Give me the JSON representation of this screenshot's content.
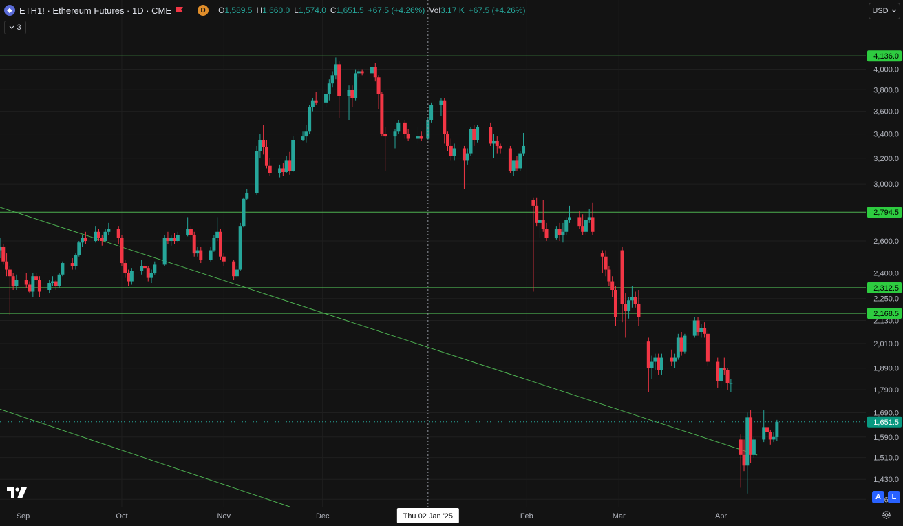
{
  "header": {
    "symbol_title": "ETH1! · Ethereum Futures · 1D · CME",
    "d_badge": "D",
    "ohlc": {
      "o_label": "O",
      "o_value": "1,589.5",
      "h_label": "H",
      "h_value": "1,660.0",
      "l_label": "L",
      "l_value": "1,574.0",
      "c_label": "C",
      "c_value": "1,651.5",
      "change": "+67.5 (+4.26%)",
      "vol_label": "Vol",
      "vol_value": "3.17 K",
      "vol_change": "+67.5 (+4.26%)"
    }
  },
  "indicator_count": "3",
  "currency_button": "USD",
  "auto_button": "A",
  "log_button": "L",
  "colors": {
    "background": "#131313",
    "up": "#26a69a",
    "down": "#f23645",
    "level_line": "#4caf50",
    "level_label": "#2ecc40",
    "last_price_label": "#089981"
  },
  "icons": [
    "ethereum-icon",
    "flag-icon",
    "chevron-down-icon",
    "tradingview-logo",
    "gear-icon"
  ],
  "chart_data": {
    "type": "candlestick",
    "scale": "log",
    "ylim": [
      1335,
      4380
    ],
    "y_ticks": [
      "4,000.0",
      "3,800.0",
      "3,600.0",
      "3,400.0",
      "3,200.0",
      "3,000.0",
      "2,600.0",
      "2,400.0",
      "2,250.0",
      "2,130.0",
      "2,010.0",
      "1,890.0",
      "1,790.0",
      "1,690.0",
      "1,590.0",
      "1,510.0",
      "1,430.0",
      "1,360.0"
    ],
    "x_ticks": [
      {
        "date": "2024-09-01",
        "label": "Sep"
      },
      {
        "date": "2024-10-01",
        "label": "Oct"
      },
      {
        "date": "2024-11-01",
        "label": "Nov"
      },
      {
        "date": "2024-12-01",
        "label": "Dec"
      },
      {
        "date": "2025-02-01",
        "label": "Feb"
      },
      {
        "date": "2025-03-01",
        "label": "Mar"
      },
      {
        "date": "2025-04-01",
        "label": "Apr"
      }
    ],
    "x_range": [
      "2024-08-25",
      "2025-05-15"
    ],
    "crosshair": {
      "date": "2025-01-02",
      "label": "Thu 02 Jan '25"
    },
    "horizontal_levels": [
      {
        "value": 4136.0,
        "label": "4,136.0"
      },
      {
        "value": 2794.5,
        "label": "2,794.5"
      },
      {
        "value": 2312.5,
        "label": "2,312.5"
      },
      {
        "value": 2168.5,
        "label": "2,168.5"
      }
    ],
    "last_price": {
      "value": 1651.5,
      "label": "1,651.5"
    },
    "trend_lines": [
      {
        "from": [
          "2024-08-25",
          2830
        ],
        "to": [
          "2025-04-12",
          1520
        ]
      },
      {
        "from": [
          "2024-08-25",
          1705
        ],
        "to": [
          "2024-11-21",
          1335
        ]
      }
    ],
    "candles": [
      [
        "2024-08-25",
        2540,
        2620,
        2490,
        2560
      ],
      [
        "2024-08-26",
        2560,
        2580,
        2450,
        2470
      ],
      [
        "2024-08-27",
        2470,
        2520,
        2380,
        2420
      ],
      [
        "2024-08-28",
        2420,
        2440,
        2160,
        2380
      ],
      [
        "2024-08-29",
        2380,
        2400,
        2300,
        2320
      ],
      [
        "2024-08-30",
        2320,
        2390,
        2300,
        2360
      ],
      [
        "2024-09-02",
        2360,
        2400,
        2310,
        2330
      ],
      [
        "2024-09-03",
        2330,
        2350,
        2280,
        2290
      ],
      [
        "2024-09-04",
        2290,
        2400,
        2260,
        2380
      ],
      [
        "2024-09-05",
        2380,
        2400,
        2330,
        2360
      ],
      [
        "2024-09-06",
        2360,
        2380,
        2260,
        2290
      ],
      [
        "2024-09-09",
        2300,
        2360,
        2280,
        2340
      ],
      [
        "2024-09-10",
        2340,
        2380,
        2320,
        2350
      ],
      [
        "2024-09-11",
        2350,
        2360,
        2300,
        2320
      ],
      [
        "2024-09-12",
        2320,
        2400,
        2310,
        2390
      ],
      [
        "2024-09-13",
        2390,
        2470,
        2380,
        2460
      ],
      [
        "2024-09-16",
        2460,
        2490,
        2420,
        2440
      ],
      [
        "2024-09-17",
        2440,
        2520,
        2420,
        2510
      ],
      [
        "2024-09-18",
        2510,
        2600,
        2500,
        2590
      ],
      [
        "2024-09-19",
        2590,
        2640,
        2560,
        2620
      ],
      [
        "2024-09-20",
        2620,
        2660,
        2580,
        2600
      ],
      [
        "2024-09-23",
        2600,
        2700,
        2590,
        2660
      ],
      [
        "2024-09-24",
        2660,
        2680,
        2600,
        2620
      ],
      [
        "2024-09-25",
        2620,
        2640,
        2570,
        2600
      ],
      [
        "2024-09-26",
        2600,
        2680,
        2590,
        2660
      ],
      [
        "2024-09-27",
        2660,
        2720,
        2640,
        2680
      ],
      [
        "2024-09-30",
        2680,
        2700,
        2580,
        2620
      ],
      [
        "2024-10-01",
        2620,
        2640,
        2440,
        2460
      ],
      [
        "2024-10-02",
        2460,
        2480,
        2370,
        2400
      ],
      [
        "2024-10-03",
        2400,
        2420,
        2320,
        2350
      ],
      [
        "2024-10-04",
        2350,
        2430,
        2330,
        2410
      ],
      [
        "2024-10-07",
        2410,
        2480,
        2390,
        2440
      ],
      [
        "2024-10-08",
        2440,
        2460,
        2400,
        2430
      ],
      [
        "2024-10-09",
        2430,
        2440,
        2350,
        2370
      ],
      [
        "2024-10-10",
        2370,
        2420,
        2340,
        2400
      ],
      [
        "2024-10-11",
        2400,
        2470,
        2390,
        2450
      ],
      [
        "2024-10-14",
        2450,
        2640,
        2440,
        2620
      ],
      [
        "2024-10-15",
        2620,
        2660,
        2580,
        2600
      ],
      [
        "2024-10-16",
        2600,
        2640,
        2570,
        2620
      ],
      [
        "2024-10-17",
        2620,
        2650,
        2580,
        2600
      ],
      [
        "2024-10-18",
        2600,
        2660,
        2590,
        2640
      ],
      [
        "2024-10-21",
        2640,
        2760,
        2630,
        2680
      ],
      [
        "2024-10-22",
        2680,
        2700,
        2610,
        2640
      ],
      [
        "2024-10-23",
        2640,
        2660,
        2500,
        2520
      ],
      [
        "2024-10-24",
        2520,
        2560,
        2500,
        2540
      ],
      [
        "2024-10-25",
        2540,
        2560,
        2460,
        2480
      ],
      [
        "2024-10-28",
        2480,
        2560,
        2470,
        2540
      ],
      [
        "2024-10-29",
        2540,
        2640,
        2530,
        2620
      ],
      [
        "2024-10-30",
        2620,
        2760,
        2600,
        2660
      ],
      [
        "2024-10-31",
        2660,
        2680,
        2480,
        2500
      ],
      [
        "2024-11-01",
        2500,
        2520,
        2440,
        2470
      ],
      [
        "2024-11-04",
        2470,
        2480,
        2360,
        2380
      ],
      [
        "2024-11-05",
        2380,
        2440,
        2370,
        2420
      ],
      [
        "2024-11-06",
        2420,
        2720,
        2410,
        2700
      ],
      [
        "2024-11-07",
        2700,
        2900,
        2690,
        2890
      ],
      [
        "2024-11-08",
        2890,
        2960,
        2880,
        2930
      ],
      [
        "2024-11-11",
        2930,
        3300,
        2920,
        3260
      ],
      [
        "2024-11-12",
        3260,
        3400,
        3200,
        3350
      ],
      [
        "2024-11-13",
        3350,
        3480,
        3230,
        3290
      ],
      [
        "2024-11-14",
        3290,
        3350,
        3120,
        3140
      ],
      [
        "2024-11-15",
        3140,
        3200,
        3060,
        3080
      ],
      [
        "2024-11-18",
        3080,
        3150,
        3050,
        3120
      ],
      [
        "2024-11-19",
        3120,
        3160,
        3060,
        3090
      ],
      [
        "2024-11-20",
        3090,
        3220,
        3080,
        3180
      ],
      [
        "2024-11-21",
        3180,
        3250,
        3070,
        3100
      ],
      [
        "2024-11-22",
        3100,
        3380,
        3090,
        3350
      ],
      [
        "2024-11-25",
        3350,
        3420,
        3340,
        3380
      ],
      [
        "2024-11-26",
        3380,
        3480,
        3330,
        3420
      ],
      [
        "2024-11-27",
        3420,
        3660,
        3400,
        3640
      ],
      [
        "2024-11-28",
        3640,
        3720,
        3600,
        3700
      ],
      [
        "2024-11-29",
        3700,
        3780,
        3660,
        3680
      ],
      [
        "2024-12-02",
        3680,
        3800,
        3640,
        3760
      ],
      [
        "2024-12-03",
        3760,
        3900,
        3700,
        3860
      ],
      [
        "2024-12-04",
        3860,
        3980,
        3820,
        3940
      ],
      [
        "2024-12-05",
        3940,
        4120,
        3900,
        4050
      ],
      [
        "2024-12-06",
        4050,
        4080,
        3540,
        3740
      ],
      [
        "2024-12-09",
        3740,
        3840,
        3520,
        3800
      ],
      [
        "2024-12-10",
        3800,
        3840,
        3640,
        3720
      ],
      [
        "2024-12-11",
        3720,
        4000,
        3700,
        3960
      ],
      [
        "2024-12-12",
        3960,
        4000,
        3920,
        3980
      ],
      [
        "2024-12-13",
        3980,
        4000,
        3940,
        3960
      ],
      [
        "2024-12-16",
        3960,
        4100,
        3940,
        4020
      ],
      [
        "2024-12-17",
        4020,
        4060,
        3880,
        3920
      ],
      [
        "2024-12-18",
        3920,
        3940,
        3620,
        3760
      ],
      [
        "2024-12-19",
        3760,
        3780,
        3380,
        3400
      ],
      [
        "2024-12-20",
        3400,
        3460,
        3100,
        3380
      ],
      [
        "2024-12-23",
        3380,
        3440,
        3280,
        3420
      ],
      [
        "2024-12-24",
        3420,
        3520,
        3400,
        3500
      ],
      [
        "2024-12-26",
        3500,
        3520,
        3360,
        3400
      ],
      [
        "2024-12-27",
        3400,
        3440,
        3340,
        3360
      ],
      [
        "2024-12-30",
        3360,
        3460,
        3320,
        3380
      ],
      [
        "2024-12-31",
        3380,
        3420,
        3340,
        3360
      ],
      [
        "2025-01-02",
        3360,
        3540,
        3350,
        3520
      ],
      [
        "2025-01-03",
        3520,
        3680,
        3500,
        3660
      ],
      [
        "2025-01-06",
        3660,
        3720,
        3560,
        3700
      ],
      [
        "2025-01-07",
        3700,
        3720,
        3320,
        3400
      ],
      [
        "2025-01-08",
        3400,
        3420,
        3260,
        3300
      ],
      [
        "2025-01-09",
        3300,
        3360,
        3180,
        3220
      ],
      [
        "2025-01-10",
        3220,
        3320,
        3180,
        3280
      ],
      [
        "2025-01-13",
        3280,
        3300,
        2960,
        3180
      ],
      [
        "2025-01-14",
        3180,
        3280,
        3150,
        3240
      ],
      [
        "2025-01-15",
        3240,
        3460,
        3220,
        3440
      ],
      [
        "2025-01-16",
        3440,
        3480,
        3300,
        3350
      ],
      [
        "2025-01-17",
        3350,
        3480,
        3330,
        3460
      ],
      [
        "2025-01-21",
        3460,
        3500,
        3300,
        3320
      ],
      [
        "2025-01-22",
        3320,
        3400,
        3200,
        3340
      ],
      [
        "2025-01-23",
        3340,
        3380,
        3240,
        3300
      ],
      [
        "2025-01-24",
        3300,
        3320,
        3240,
        3280
      ],
      [
        "2025-01-27",
        3280,
        3300,
        3080,
        3100
      ],
      [
        "2025-01-28",
        3100,
        3180,
        3060,
        3180
      ],
      [
        "2025-01-29",
        3180,
        3220,
        3100,
        3120
      ],
      [
        "2025-01-30",
        3120,
        3260,
        3100,
        3240
      ],
      [
        "2025-01-31",
        3240,
        3410,
        3220,
        3300
      ],
      [
        "2025-02-03",
        2880,
        2900,
        2290,
        2840
      ],
      [
        "2025-02-04",
        2840,
        2900,
        2700,
        2720
      ],
      [
        "2025-02-05",
        2720,
        2780,
        2620,
        2740
      ],
      [
        "2025-02-06",
        2740,
        2880,
        2660,
        2680
      ],
      [
        "2025-02-07",
        2680,
        2720,
        2600,
        2620
      ],
      [
        "2025-02-10",
        2620,
        2700,
        2610,
        2680
      ],
      [
        "2025-02-11",
        2680,
        2720,
        2600,
        2640
      ],
      [
        "2025-02-12",
        2640,
        2720,
        2590,
        2660
      ],
      [
        "2025-02-13",
        2660,
        2760,
        2640,
        2740
      ],
      [
        "2025-02-14",
        2740,
        2840,
        2720,
        2760
      ],
      [
        "2025-02-17",
        2760,
        2800,
        2680,
        2700
      ],
      [
        "2025-02-18",
        2700,
        2780,
        2640,
        2660
      ],
      [
        "2025-02-19",
        2660,
        2780,
        2640,
        2740
      ],
      [
        "2025-02-20",
        2740,
        2820,
        2720,
        2760
      ],
      [
        "2025-02-21",
        2760,
        2860,
        2640,
        2660
      ],
      [
        "2025-02-24",
        2520,
        2540,
        2400,
        2500
      ],
      [
        "2025-02-25",
        2500,
        2540,
        2380,
        2420
      ],
      [
        "2025-02-26",
        2420,
        2440,
        2320,
        2350
      ],
      [
        "2025-02-27",
        2350,
        2380,
        2260,
        2300
      ],
      [
        "2025-02-28",
        2300,
        2320,
        2100,
        2150
      ],
      [
        "2025-03-02",
        2540,
        2560,
        2120,
        2220
      ],
      [
        "2025-03-03",
        2220,
        2280,
        2040,
        2180
      ],
      [
        "2025-03-04",
        2180,
        2260,
        2140,
        2240
      ],
      [
        "2025-03-05",
        2240,
        2320,
        2200,
        2260
      ],
      [
        "2025-03-06",
        2260,
        2290,
        2200,
        2220
      ],
      [
        "2025-03-07",
        2220,
        2300,
        2100,
        2150
      ],
      [
        "2025-03-10",
        2020,
        2040,
        1780,
        1890
      ],
      [
        "2025-03-11",
        1890,
        1950,
        1840,
        1920
      ],
      [
        "2025-03-12",
        1920,
        1960,
        1880,
        1940
      ],
      [
        "2025-03-13",
        1940,
        1960,
        1860,
        1880
      ],
      [
        "2025-03-14",
        1880,
        1960,
        1860,
        1940
      ],
      [
        "2025-03-17",
        1940,
        1980,
        1900,
        1920
      ],
      [
        "2025-03-18",
        1920,
        1960,
        1890,
        1940
      ],
      [
        "2025-03-19",
        1940,
        2060,
        1930,
        2040
      ],
      [
        "2025-03-20",
        2040,
        2070,
        1950,
        1970
      ],
      [
        "2025-03-21",
        1970,
        2060,
        1960,
        2050
      ],
      [
        "2025-03-24",
        2050,
        2150,
        2040,
        2130
      ],
      [
        "2025-03-25",
        2130,
        2150,
        2050,
        2070
      ],
      [
        "2025-03-26",
        2070,
        2110,
        2040,
        2090
      ],
      [
        "2025-03-27",
        2090,
        2120,
        2040,
        2060
      ],
      [
        "2025-03-28",
        2060,
        2080,
        1900,
        1920
      ],
      [
        "2025-03-31",
        1920,
        1940,
        1800,
        1830
      ],
      [
        "2025-04-01",
        1830,
        1920,
        1800,
        1890
      ],
      [
        "2025-04-02",
        1890,
        1940,
        1860,
        1880
      ],
      [
        "2025-04-03",
        1880,
        1890,
        1790,
        1820
      ],
      [
        "2025-04-04",
        1820,
        1840,
        1780,
        1820
      ],
      [
        "2025-04-07",
        1580,
        1600,
        1400,
        1520
      ],
      [
        "2025-04-08",
        1520,
        1580,
        1460,
        1480
      ],
      [
        "2025-04-09",
        1480,
        1690,
        1380,
        1670
      ],
      [
        "2025-04-10",
        1670,
        1700,
        1490,
        1520
      ],
      [
        "2025-04-11",
        1520,
        1590,
        1510,
        1580
      ],
      [
        "2025-04-14",
        1580,
        1700,
        1570,
        1630
      ],
      [
        "2025-04-15",
        1630,
        1650,
        1600,
        1610
      ],
      [
        "2025-04-16",
        1610,
        1620,
        1560,
        1580
      ],
      [
        "2025-04-17",
        1580,
        1610,
        1570,
        1590
      ],
      [
        "2025-04-18",
        1589.5,
        1660,
        1574,
        1651.5
      ]
    ]
  }
}
